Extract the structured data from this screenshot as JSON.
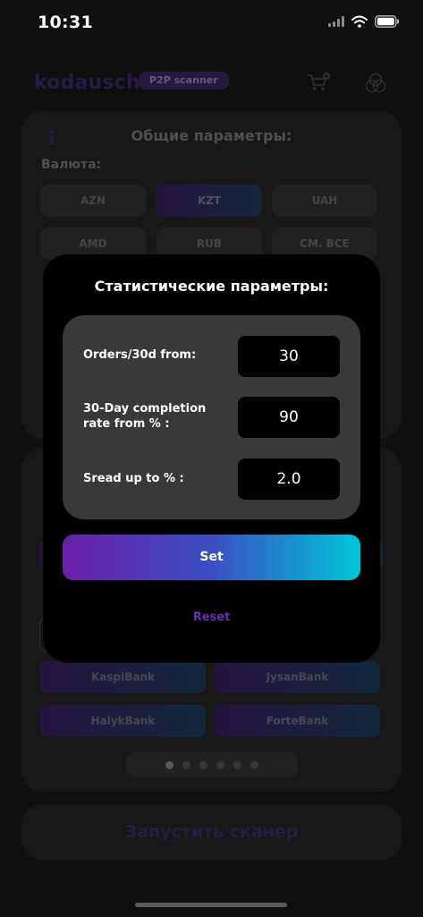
{
  "status_bar": {
    "time": "10:31"
  },
  "header": {
    "logo": "kodausch",
    "badge": "P2P scanner"
  },
  "general": {
    "title": "Общие параметры:",
    "info_glyph": "i",
    "currency_label": "Валюта:",
    "currencies": [
      {
        "label": "AZN",
        "active": false
      },
      {
        "label": "KZT",
        "active": true
      },
      {
        "label": "UAH",
        "active": false
      },
      {
        "label": "AMD",
        "active": false
      },
      {
        "label": "RUB",
        "active": false
      },
      {
        "label": "СМ. ВСЕ",
        "active": false
      }
    ]
  },
  "banks": [
    "KaspiBank",
    "JysanBank",
    "HalykBank",
    "ForteBank"
  ],
  "pager": {
    "count": 6,
    "active_index": 0
  },
  "start_button": "Запустить сканер",
  "modal": {
    "title": "Статистические параметры:",
    "rows": [
      {
        "label": "Orders/30d from:",
        "value": "30"
      },
      {
        "label": "30-Day completion rate from % :",
        "value": "90"
      },
      {
        "label": "Sread up to % :",
        "value": "2.0"
      }
    ],
    "set_label": "Set",
    "reset_label": "Reset"
  },
  "colors": {
    "accent_purple": "#6b1fa8",
    "accent_cyan": "#00c6d8",
    "reset_text": "#6a2fb0"
  }
}
